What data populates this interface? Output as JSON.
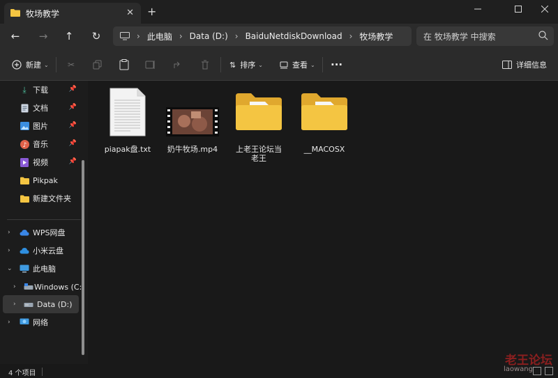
{
  "window": {
    "tab_title": "牧场教学",
    "close_tab": "✕",
    "new_tab": "+"
  },
  "address": {
    "path": [
      "此电脑",
      "Data (D:)",
      "BaiduNetdiskDownload",
      "牧场教学"
    ],
    "search_placeholder": "在 牧场教学 中搜索"
  },
  "toolbar": {
    "new_label": "新建",
    "sort_label": "排序",
    "view_label": "查看",
    "more_label": "···",
    "details_label": "详细信息"
  },
  "sidebar": {
    "quick_access": [
      {
        "label": "下载",
        "icon": "download-icon",
        "pinned": true
      },
      {
        "label": "文档",
        "icon": "document-icon",
        "pinned": true
      },
      {
        "label": "图片",
        "icon": "picture-icon",
        "pinned": true
      },
      {
        "label": "音乐",
        "icon": "music-icon",
        "pinned": true
      },
      {
        "label": "视频",
        "icon": "video-icon",
        "pinned": true
      },
      {
        "label": "Pikpak",
        "icon": "folder-icon",
        "pinned": false
      },
      {
        "label": "新建文件夹",
        "icon": "folder-icon",
        "pinned": false
      }
    ],
    "tree": [
      {
        "label": "WPS网盘",
        "icon": "cloud-icon",
        "expand": "›"
      },
      {
        "label": "小米云盘",
        "icon": "cloud-icon",
        "expand": "›"
      },
      {
        "label": "此电脑",
        "icon": "computer-icon",
        "expand": "⌄"
      },
      {
        "label": "Windows (C:)",
        "icon": "drive-icon",
        "expand": "›"
      },
      {
        "label": "Data (D:)",
        "icon": "drive-icon",
        "expand": "›"
      },
      {
        "label": "网络",
        "icon": "network-icon",
        "expand": "›"
      }
    ]
  },
  "files": [
    {
      "name": "piapak盘.txt",
      "type": "text-file"
    },
    {
      "name": "奶牛牧场.mp4",
      "type": "video-file"
    },
    {
      "name": "上老王论坛当老王",
      "type": "folder"
    },
    {
      "name": "__MACOSX",
      "type": "folder"
    }
  ],
  "status": {
    "item_count": "4 个项目"
  },
  "watermark": {
    "cn": "老王论坛",
    "en": "laowang"
  },
  "colors": {
    "folder_yellow": "#f4c542",
    "accent_blue": "#4fa3e8"
  }
}
